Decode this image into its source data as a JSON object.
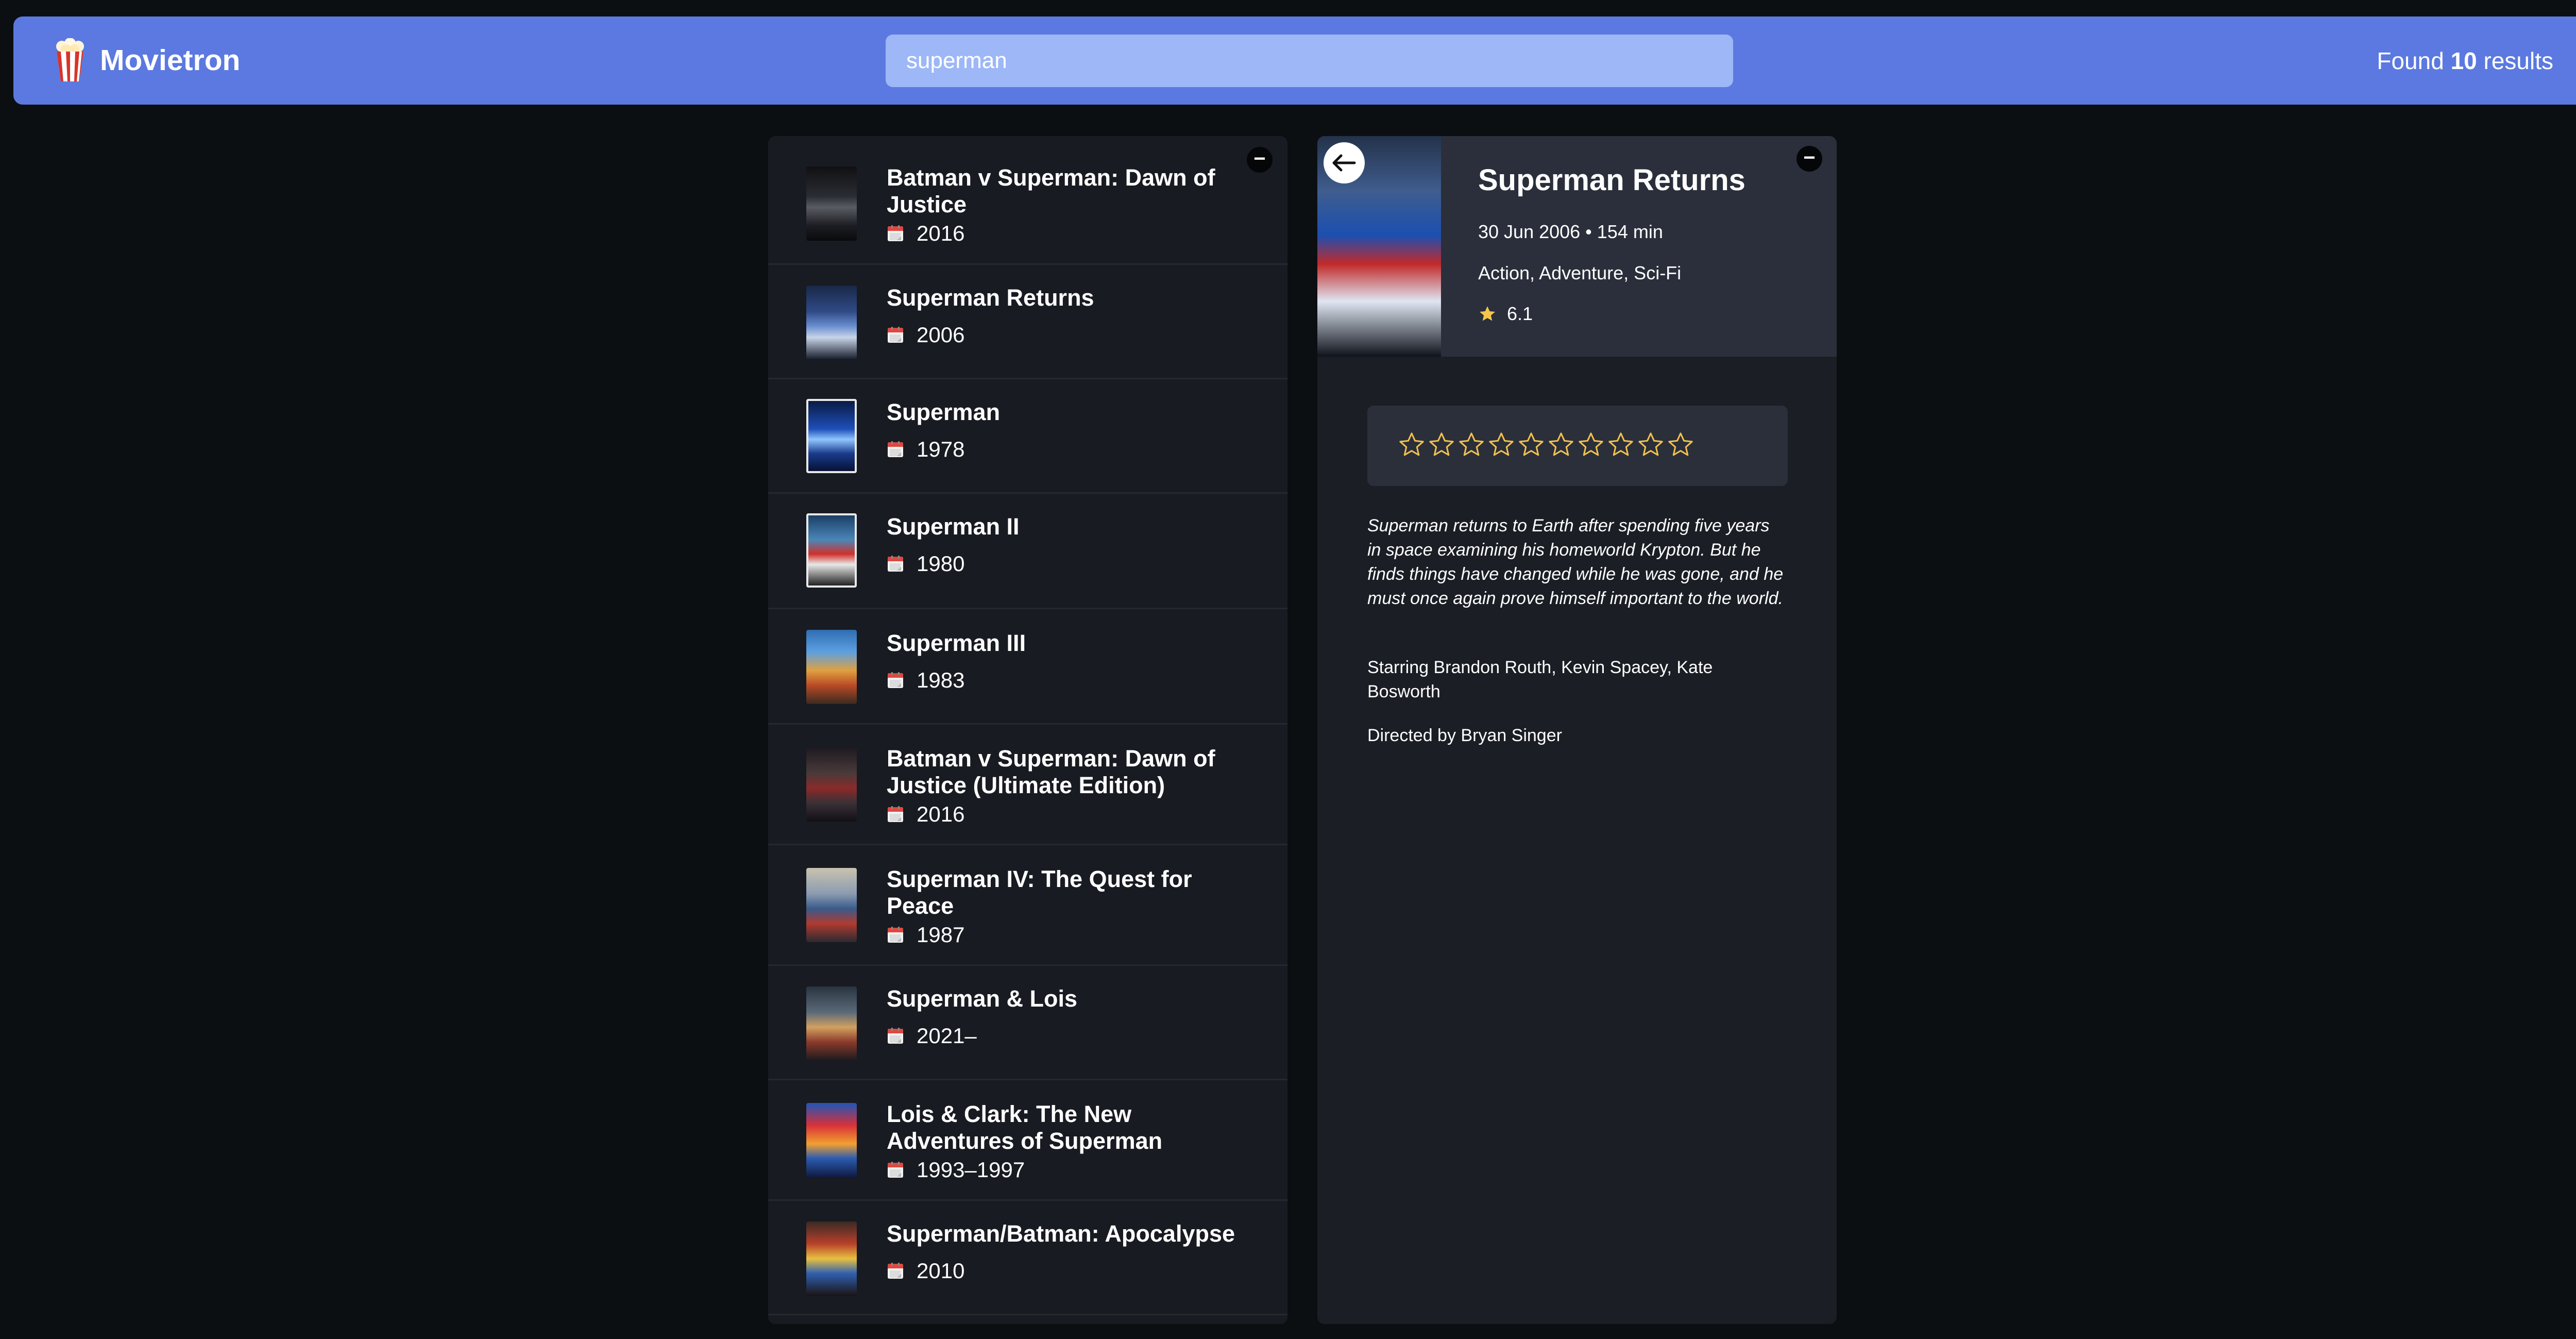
{
  "app": {
    "name": "Movietron",
    "logo_icon": "popcorn-icon",
    "accent_color": "#5b79e0"
  },
  "search": {
    "value": "superman",
    "placeholder": ""
  },
  "results": {
    "prefix": "Found",
    "count": "10",
    "suffix": "results"
  },
  "list_panel": {
    "minimize_label": "−",
    "items": [
      {
        "title": "Batman v Superman: Dawn of Justice",
        "year": "2016"
      },
      {
        "title": "Superman Returns",
        "year": "2006"
      },
      {
        "title": "Superman",
        "year": "1978"
      },
      {
        "title": "Superman II",
        "year": "1980"
      },
      {
        "title": "Superman III",
        "year": "1983"
      },
      {
        "title": "Batman v Superman: Dawn of Justice (Ultimate Edition)",
        "year": "2016"
      },
      {
        "title": "Superman IV: The Quest for Peace",
        "year": "1987"
      },
      {
        "title": "Superman & Lois",
        "year": "2021–"
      },
      {
        "title": "Lois & Clark: The New Adventures of Superman",
        "year": "1993–1997"
      },
      {
        "title": "Superman/Batman: Apocalypse",
        "year": "2010"
      }
    ]
  },
  "detail": {
    "minimize_label": "−",
    "title": "Superman Returns",
    "meta": "30 Jun 2006 • 154 min",
    "genres": "Action, Adventure, Sci-Fi",
    "rating": "6.1",
    "user_rating_stars_total": 10,
    "user_rating_stars_filled": 0,
    "star_color": "#f2c14e",
    "synopsis": "Superman returns to Earth after spending five years in space examining his homeworld Krypton. But he finds things have changed while he was gone, and he must once again prove himself important to the world.",
    "starring": "Starring Brandon Routh, Kevin Spacey, Kate Bosworth",
    "directed": "Directed by Bryan Singer"
  }
}
